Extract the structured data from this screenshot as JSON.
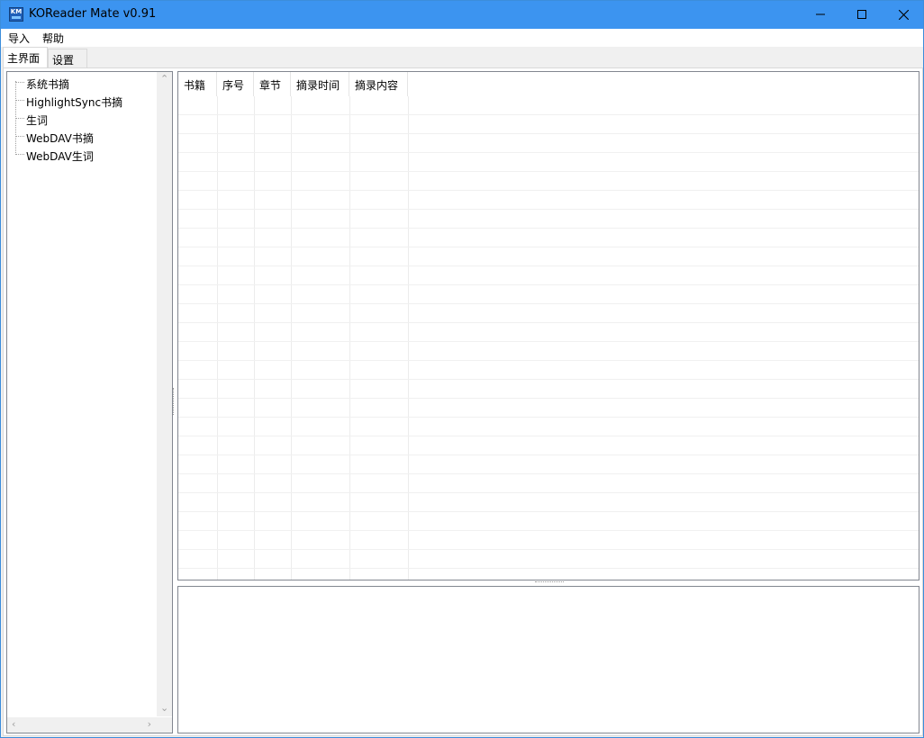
{
  "window": {
    "title": "KOReader Mate v0.91",
    "icon": "app-logo-icon",
    "icon_text": "KM",
    "accent": "#3c94f0"
  },
  "menu": {
    "items": [
      {
        "label": "导入"
      },
      {
        "label": "帮助"
      }
    ]
  },
  "tabs": [
    {
      "label": "主界面",
      "active": true
    },
    {
      "label": "设置",
      "active": false
    }
  ],
  "tree": {
    "items": [
      {
        "label": "系统书摘"
      },
      {
        "label": "HighlightSync书摘"
      },
      {
        "label": "生词"
      },
      {
        "label": "WebDAV书摘"
      },
      {
        "label": "WebDAV生词"
      }
    ]
  },
  "table": {
    "columns": [
      "书籍",
      "序号",
      "章节",
      "摘录时间",
      "摘录内容"
    ],
    "rows": []
  },
  "detail": {
    "content": ""
  }
}
